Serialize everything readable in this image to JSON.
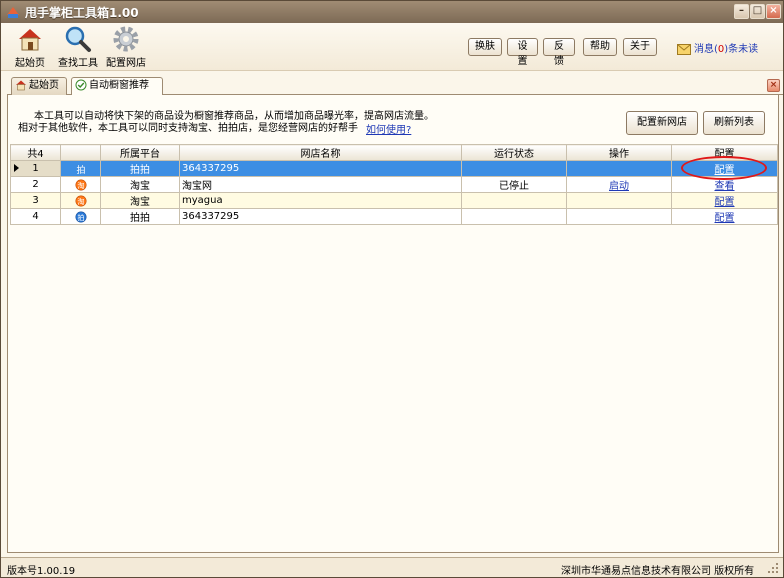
{
  "window": {
    "title": "甩手掌柜工具箱1.00"
  },
  "toolbar": {
    "tools": [
      {
        "label": "起始页",
        "icon": "home-icon"
      },
      {
        "label": "查找工具",
        "icon": "magnifier-icon"
      },
      {
        "label": "配置网店",
        "icon": "gear-icon"
      }
    ],
    "buttons": [
      "换肤",
      "设置",
      "反馈",
      "帮助",
      "关于"
    ],
    "message": {
      "prefix": "消息(",
      "count": "0",
      "suffix": ")条未读"
    }
  },
  "tabs": [
    {
      "label": "起始页",
      "icon": "home-icon"
    },
    {
      "label": "自动橱窗推荐",
      "icon": "check-icon"
    }
  ],
  "panel": {
    "desc_line1": "本工具可以自动将快下架的商品设为橱窗推荐商品，从而增加商品曝光率，提高网店流量。",
    "desc_line2": "相对于其他软件，本工具可以同时支持淘宝、拍拍店，是您经营网店的好帮手",
    "howto_link": "如何使用?",
    "btn_new_shop": "配置新网店",
    "btn_refresh": "刷新列表"
  },
  "grid": {
    "columns": [
      "共4",
      "",
      "所属平台",
      "网店名称",
      "运行状态",
      "操作",
      "配置"
    ],
    "rows": [
      {
        "no": "1",
        "platform_icon": "paipai-icon",
        "platform": "拍拍",
        "shop": "364337295",
        "status": "",
        "action": "",
        "config": "配置"
      },
      {
        "no": "2",
        "platform_icon": "taobao-icon",
        "platform": "淘宝",
        "shop": "淘宝网",
        "status": "已停止",
        "action": "启动",
        "config": "查看"
      },
      {
        "no": "3",
        "platform_icon": "taobao-icon",
        "platform": "淘宝",
        "shop": "myagua",
        "status": "",
        "action": "",
        "config": "配置"
      },
      {
        "no": "4",
        "platform_icon": "paipai-icon",
        "platform": "拍拍",
        "shop": "364337295",
        "status": "",
        "action": "",
        "config": "配置"
      }
    ]
  },
  "statusbar": {
    "version": "版本号1.00.19",
    "copyright": "深圳市华通易点信息技术有限公司 版权所有"
  },
  "colors": {
    "selection": "#3d8ee3",
    "highlight_circle": "#e01818",
    "link": "#1f39b5"
  }
}
